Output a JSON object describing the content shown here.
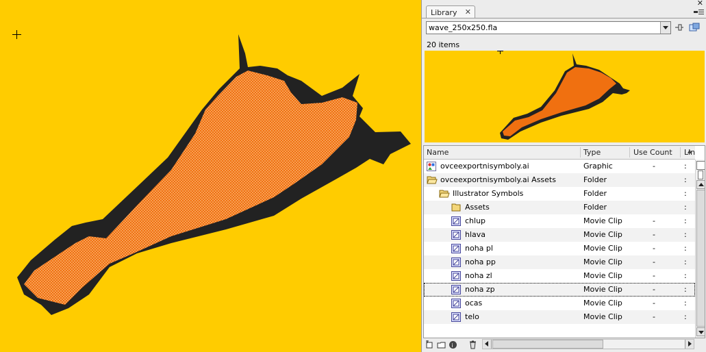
{
  "colors": {
    "stage_background": "#ffcc00",
    "shape_fill": "#f07010",
    "shape_outline": "#222222",
    "selection_hatch": "#ffd9a8"
  },
  "library": {
    "tab_label": "Library",
    "tab_close_glyph": "✕",
    "panel_close_glyph": "✕",
    "document": "wave_250x250.fla",
    "item_count": "20 items",
    "columns": {
      "name": "Name",
      "type": "Type",
      "use_count": "Use Count",
      "linkage": "Lin"
    },
    "items": [
      {
        "name": "ovceexportnisymboly.ai",
        "type": "Graphic",
        "use_count": "-",
        "linkage": ":",
        "icon": "graphic-symbol-icon",
        "depth": 0
      },
      {
        "name": "ovceexportnisymboly.ai Assets",
        "type": "Folder",
        "use_count": "",
        "linkage": ":",
        "icon": "folder-open-icon",
        "depth": 0
      },
      {
        "name": "Illustrator Symbols",
        "type": "Folder",
        "use_count": "",
        "linkage": ":",
        "icon": "folder-open-icon",
        "depth": 1
      },
      {
        "name": "Assets",
        "type": "Folder",
        "use_count": "",
        "linkage": ":",
        "icon": "folder-icon",
        "depth": 2
      },
      {
        "name": "chlup",
        "type": "Movie Clip",
        "use_count": "-",
        "linkage": ":",
        "icon": "movie-clip-icon",
        "depth": 2
      },
      {
        "name": "hlava",
        "type": "Movie Clip",
        "use_count": "-",
        "linkage": ":",
        "icon": "movie-clip-icon",
        "depth": 2
      },
      {
        "name": "noha pl",
        "type": "Movie Clip",
        "use_count": "-",
        "linkage": ":",
        "icon": "movie-clip-icon",
        "depth": 2
      },
      {
        "name": "noha pp",
        "type": "Movie Clip",
        "use_count": "-",
        "linkage": ":",
        "icon": "movie-clip-icon",
        "depth": 2
      },
      {
        "name": "noha zl",
        "type": "Movie Clip",
        "use_count": "-",
        "linkage": ":",
        "icon": "movie-clip-icon",
        "depth": 2
      },
      {
        "name": "noha zp",
        "type": "Movie Clip",
        "use_count": "-",
        "linkage": ":",
        "icon": "movie-clip-icon",
        "depth": 2,
        "selected": true
      },
      {
        "name": "ocas",
        "type": "Movie Clip",
        "use_count": "-",
        "linkage": ":",
        "icon": "movie-clip-icon",
        "depth": 2
      },
      {
        "name": "telo",
        "type": "Movie Clip",
        "use_count": "-",
        "linkage": ":",
        "icon": "movie-clip-icon",
        "depth": 2
      }
    ]
  }
}
